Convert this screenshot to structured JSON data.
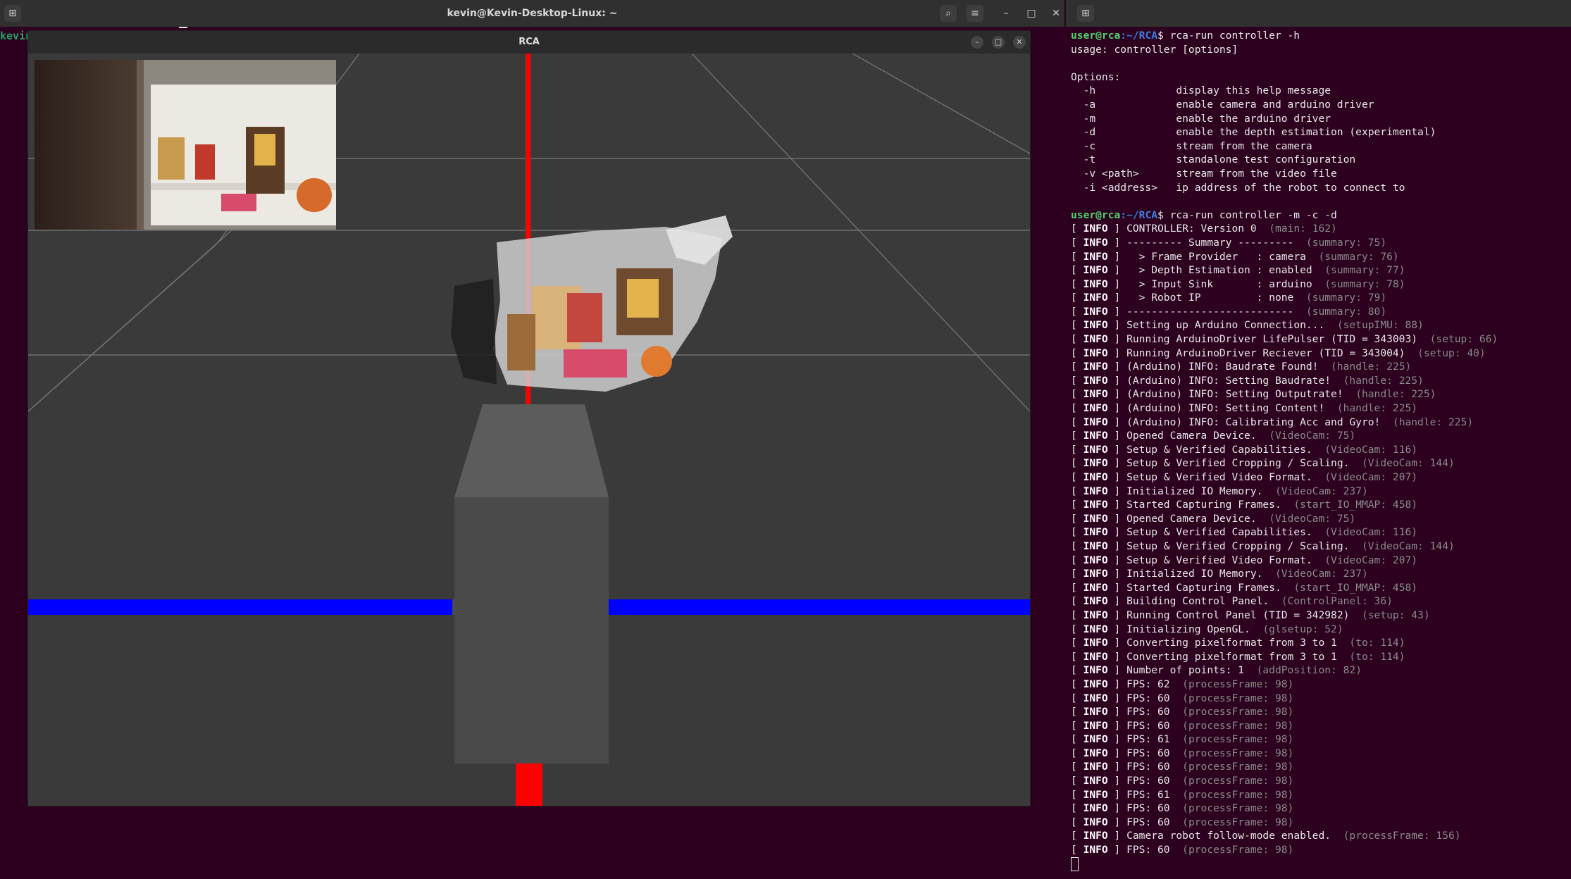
{
  "left_window": {
    "title": "kevin@Kevin-Desktop-Linux: ~",
    "prompt_fragment": "kevin"
  },
  "rca_window": {
    "title": "RCA"
  },
  "colors": {
    "terminal_bg": "#2c001e",
    "prompt_green": "#4fd36b",
    "path_blue": "#3d7fe0",
    "axis_red": "#ff0000",
    "axis_blue": "#0000ff"
  },
  "terminal": {
    "lines": [
      {
        "kind": "prompt",
        "user": "user@rca",
        "path": ":~/RCA",
        "cmd": "$ rca-run controller -h"
      },
      {
        "kind": "text",
        "text": "usage: controller [options]"
      },
      {
        "kind": "text",
        "text": ""
      },
      {
        "kind": "text",
        "text": "Options:"
      },
      {
        "kind": "text",
        "text": "  -h             display this help message"
      },
      {
        "kind": "text",
        "text": "  -a             enable camera and arduino driver"
      },
      {
        "kind": "text",
        "text": "  -m             enable the arduino driver"
      },
      {
        "kind": "text",
        "text": "  -d             enable the depth estimation (experimental)"
      },
      {
        "kind": "text",
        "text": "  -c             stream from the camera"
      },
      {
        "kind": "text",
        "text": "  -t             standalone test configuration"
      },
      {
        "kind": "text",
        "text": "  -v <path>      stream from the video file"
      },
      {
        "kind": "text",
        "text": "  -i <address>   ip address of the robot to connect to"
      },
      {
        "kind": "text",
        "text": ""
      },
      {
        "kind": "prompt",
        "user": "user@rca",
        "path": ":~/RCA",
        "cmd": "$ rca-run controller -m -c -d"
      },
      {
        "kind": "log",
        "msg": "CONTROLLER: Version 0",
        "src": "(main: 162)"
      },
      {
        "kind": "log",
        "msg": "--------- Summary ---------",
        "src": "(summary: 75)"
      },
      {
        "kind": "log",
        "msg": "  > Frame Provider   : camera",
        "src": "(summary: 76)"
      },
      {
        "kind": "log",
        "msg": "  > Depth Estimation : enabled",
        "src": "(summary: 77)"
      },
      {
        "kind": "log",
        "msg": "  > Input Sink       : arduino",
        "src": "(summary: 78)"
      },
      {
        "kind": "log",
        "msg": "  > Robot IP         : none",
        "src": "(summary: 79)"
      },
      {
        "kind": "log",
        "msg": "---------------------------",
        "src": "(summary: 80)"
      },
      {
        "kind": "log",
        "msg": "Setting up Arduino Connection...",
        "src": "(setupIMU: 88)"
      },
      {
        "kind": "log",
        "msg": "Running ArduinoDriver LifePulser (TID = 343003)",
        "src": "(setup: 66)"
      },
      {
        "kind": "log",
        "msg": "Running ArduinoDriver Reciever (TID = 343004)",
        "src": "(setup: 40)"
      },
      {
        "kind": "log",
        "msg": "(Arduino) INFO: Baudrate Found!",
        "src": "(handle: 225)"
      },
      {
        "kind": "log",
        "msg": "(Arduino) INFO: Setting Baudrate!",
        "src": "(handle: 225)"
      },
      {
        "kind": "log",
        "msg": "(Arduino) INFO: Setting Outputrate!",
        "src": "(handle: 225)"
      },
      {
        "kind": "log",
        "msg": "(Arduino) INFO: Setting Content!",
        "src": "(handle: 225)"
      },
      {
        "kind": "log",
        "msg": "(Arduino) INFO: Calibrating Acc and Gyro!",
        "src": "(handle: 225)"
      },
      {
        "kind": "log",
        "msg": "Opened Camera Device.",
        "src": "(VideoCam: 75)"
      },
      {
        "kind": "log",
        "msg": "Setup & Verified Capabilities.",
        "src": "(VideoCam: 116)"
      },
      {
        "kind": "log",
        "msg": "Setup & Verified Cropping / Scaling.",
        "src": "(VideoCam: 144)"
      },
      {
        "kind": "log",
        "msg": "Setup & Verified Video Format.",
        "src": "(VideoCam: 207)"
      },
      {
        "kind": "log",
        "msg": "Initialized IO Memory.",
        "src": "(VideoCam: 237)"
      },
      {
        "kind": "log",
        "msg": "Started Capturing Frames.",
        "src": "(start_IO_MMAP: 458)"
      },
      {
        "kind": "log",
        "msg": "Opened Camera Device.",
        "src": "(VideoCam: 75)"
      },
      {
        "kind": "log",
        "msg": "Setup & Verified Capabilities.",
        "src": "(VideoCam: 116)"
      },
      {
        "kind": "log",
        "msg": "Setup & Verified Cropping / Scaling.",
        "src": "(VideoCam: 144)"
      },
      {
        "kind": "log",
        "msg": "Setup & Verified Video Format.",
        "src": "(VideoCam: 207)"
      },
      {
        "kind": "log",
        "msg": "Initialized IO Memory.",
        "src": "(VideoCam: 237)"
      },
      {
        "kind": "log",
        "msg": "Started Capturing Frames.",
        "src": "(start_IO_MMAP: 458)"
      },
      {
        "kind": "log",
        "msg": "Building Control Panel.",
        "src": "(ControlPanel: 36)"
      },
      {
        "kind": "log",
        "msg": "Running Control Panel (TID = 342982)",
        "src": "(setup: 43)"
      },
      {
        "kind": "log",
        "msg": "Initializing OpenGL.",
        "src": "(glsetup: 52)"
      },
      {
        "kind": "log",
        "msg": "Converting pixelformat from 3 to 1",
        "src": "(to: 114)"
      },
      {
        "kind": "log",
        "msg": "Converting pixelformat from 3 to 1",
        "src": "(to: 114)"
      },
      {
        "kind": "log",
        "msg": "Number of points: 1",
        "src": "(addPosition: 82)"
      },
      {
        "kind": "log",
        "msg": "FPS: 62",
        "src": "(processFrame: 98)"
      },
      {
        "kind": "log",
        "msg": "FPS: 60",
        "src": "(processFrame: 98)"
      },
      {
        "kind": "log",
        "msg": "FPS: 60",
        "src": "(processFrame: 98)"
      },
      {
        "kind": "log",
        "msg": "FPS: 60",
        "src": "(processFrame: 98)"
      },
      {
        "kind": "log",
        "msg": "FPS: 61",
        "src": "(processFrame: 98)"
      },
      {
        "kind": "log",
        "msg": "FPS: 60",
        "src": "(processFrame: 98)"
      },
      {
        "kind": "log",
        "msg": "FPS: 60",
        "src": "(processFrame: 98)"
      },
      {
        "kind": "log",
        "msg": "FPS: 60",
        "src": "(processFrame: 98)"
      },
      {
        "kind": "log",
        "msg": "FPS: 61",
        "src": "(processFrame: 98)"
      },
      {
        "kind": "log",
        "msg": "FPS: 60",
        "src": "(processFrame: 98)"
      },
      {
        "kind": "log",
        "msg": "FPS: 60",
        "src": "(processFrame: 98)"
      },
      {
        "kind": "log",
        "msg": "Camera robot follow-mode enabled.",
        "src": "(processFrame: 156)"
      },
      {
        "kind": "log",
        "msg": "FPS: 60",
        "src": "(processFrame: 98)"
      }
    ],
    "log_open": "[ ",
    "log_level": "INFO",
    "log_close": " ] "
  }
}
